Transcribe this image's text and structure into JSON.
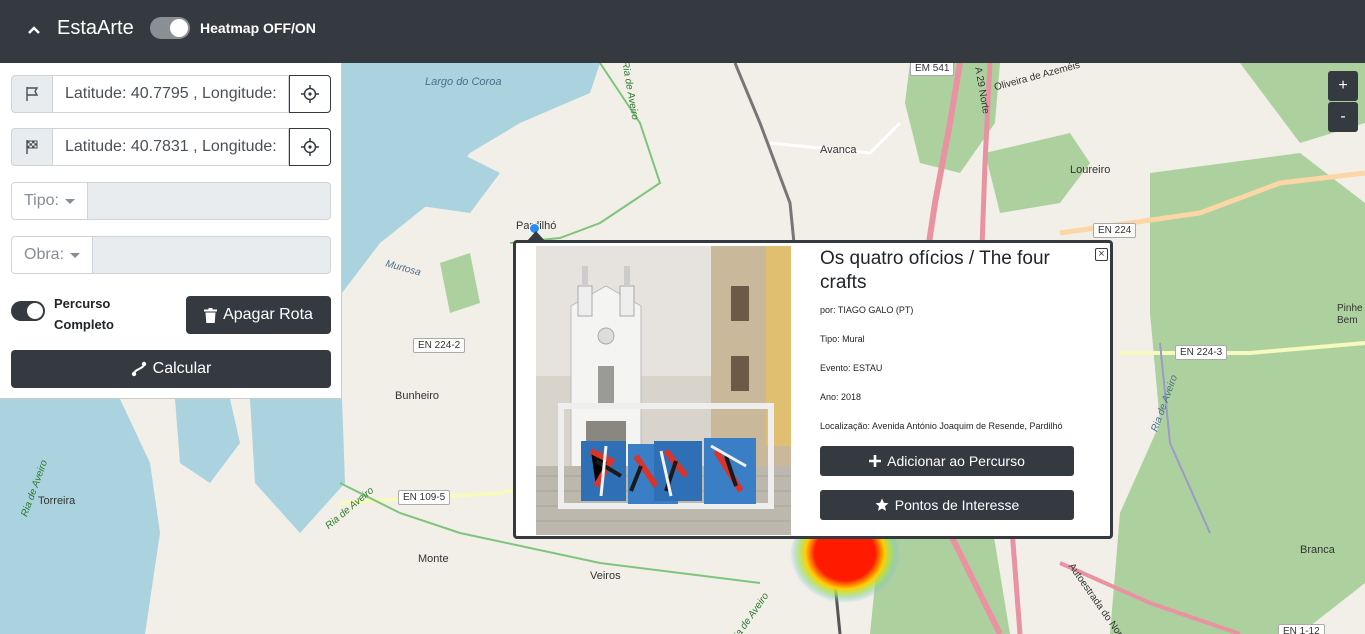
{
  "navbar": {
    "brand": "EstaArte",
    "heatmap_label": "Heatmap OFF/ON",
    "heatmap_on": true
  },
  "sidebar": {
    "start_value": "Latitude: 40.7795 , Longitude:",
    "end_value": "Latitude: 40.7831 , Longitude:",
    "tipo_label": "Tipo:",
    "obra_label": "Obra:",
    "percurso_label": "Percurso Completo",
    "percurso_on": true,
    "apagar_label": "Apagar Rota",
    "calcular_label": "Calcular"
  },
  "map": {
    "zoom_in": "+",
    "zoom_out": "-",
    "places": [
      "Largo do Coroa",
      "Ria de Aveiro",
      "Avanca",
      "Loureiro",
      "Pardilhó",
      "Murtosa",
      "Bunheiro",
      "Torreira",
      "Monte",
      "Veiros",
      "Branca",
      "Pinhe Bem",
      "Ria de Aveiro",
      "Ria de Aveiro",
      "Ria de Aveiro",
      "Ria de Aveiro"
    ],
    "roads": [
      "EM 541",
      "EN 224",
      "EN 224-2",
      "EN 224-3",
      "EN 109-5",
      "EN 1-12",
      "A 29 Norte",
      "Oliveira de Azeméis",
      "Autoestrada do Norte"
    ],
    "heatmap_color": "#ff1a00",
    "water_color": "#aad3df",
    "forest_color": "#add19e"
  },
  "popup": {
    "title": "Os quatro ofícios / The four crafts",
    "author": "por: TIAGO GALO (PT)",
    "tipo": "Tipo: Mural",
    "evento": "Evento: ESTAU",
    "ano": "Ano: 2018",
    "localizacao": "Localização: Avenida António Joaquim de Resende, Pardilhó",
    "add_label": "Adicionar ao Percurso",
    "poi_label": "Pontos de Interesse",
    "close": "×"
  }
}
